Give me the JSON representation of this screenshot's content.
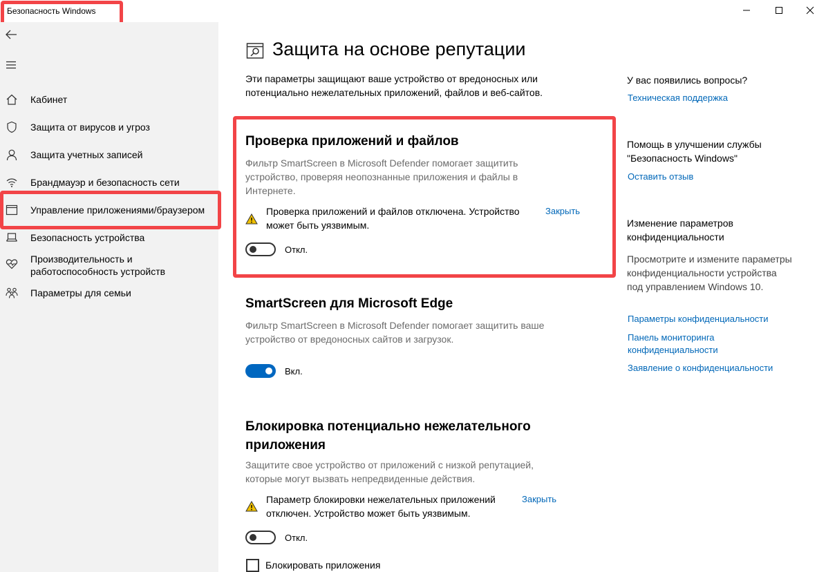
{
  "window": {
    "title": "Безопасность Windows",
    "controls": [
      "minimize",
      "maximize",
      "close"
    ]
  },
  "sidebar": {
    "items": [
      {
        "label": "Кабинет",
        "icon": "home-icon"
      },
      {
        "label": "Защита от вирусов и угроз",
        "icon": "shield-icon"
      },
      {
        "label": "Защита учетных записей",
        "icon": "person-icon"
      },
      {
        "label": "Брандмауэр и безопасность сети",
        "icon": "wifi-icon"
      },
      {
        "label": "Управление приложениями/браузером",
        "icon": "app-window-icon",
        "selected": true
      },
      {
        "label": "Безопасность устройства",
        "icon": "laptop-icon"
      },
      {
        "label": "Производительность и работоспособность устройств",
        "icon": "heart-pulse-icon"
      },
      {
        "label": "Параметры для семьи",
        "icon": "family-icon"
      }
    ]
  },
  "main": {
    "title": "Защита на основе репутации",
    "description": "Эти параметры защищают ваше устройство от вредоносных или потенциально нежелательных приложений, файлов и веб-сайтов.",
    "sections": [
      {
        "title": "Проверка приложений и файлов",
        "description": "Фильтр SmartScreen в Microsoft Defender помогает защитить устройство, проверяя неопознанные приложения и файлы в Интернете.",
        "warning": "Проверка приложений и файлов отключена. Устройство может быть уязвимым.",
        "close_label": "Закрыть",
        "toggle_state": "off",
        "toggle_label": "Откл."
      },
      {
        "title": "SmartScreen для Microsoft Edge",
        "description": "Фильтр SmartScreen в Microsoft Defender помогает защитить ваше устройство от вредоносных сайтов и загрузок.",
        "toggle_state": "on",
        "toggle_label": "Вкл."
      },
      {
        "title": "Блокировка потенциально нежелательного приложения",
        "description": "Защитите свое устройство от приложений с низкой репутацией, которые могут вызвать непредвиденные действия.",
        "warning": "Параметр блокировки нежелательных приложений отключен. Устройство может быть уязвимым.",
        "close_label": "Закрыть",
        "toggle_state": "off",
        "toggle_label": "Откл.",
        "checkbox_label": "Блокировать приложения"
      }
    ]
  },
  "right": {
    "questions_heading": "У вас появились вопросы?",
    "support_link": "Техническая поддержка",
    "improve_heading": "Помощь в улучшении службы \"Безопасность Windows\"",
    "feedback_link": "Оставить отзыв",
    "privacy_heading": "Изменение параметров конфиденциальности",
    "privacy_text": "Просмотрите и измените параметры конфиденциальности устройства под управлением Windows 10.",
    "privacy_links": [
      "Параметры конфиденциальности",
      "Панель мониторинга конфиденциальности",
      "Заявление о конфиденциальности"
    ]
  },
  "colors": {
    "accent": "#0067c0",
    "link": "#0067b8",
    "highlight": "#f24447",
    "sidebar_bg": "#f2f2f2",
    "warning": "#f0c000"
  }
}
